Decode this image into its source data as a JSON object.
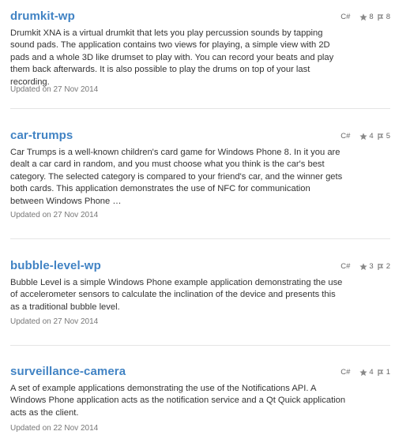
{
  "repos": [
    {
      "name": "drumkit-wp",
      "language": "C#",
      "stars": "8",
      "forks": "8",
      "description": "Drumkit XNA is a virtual drumkit that lets you play percussion sounds by tapping sound pads. The application contains two views for playing, a simple view with 2D pads and a whole 3D like drumset to play with. You can record your beats and play them back afterwards. It is also possible to play the drums on top of your last recording.",
      "updated": "Updated on 27 Nov 2014"
    },
    {
      "name": "car-trumps",
      "language": "C#",
      "stars": "4",
      "forks": "5",
      "description": "Car Trumps is a well-known children's card game for Windows Phone 8. In it you are dealt a car card in random, and you must choose what you think is the car's best category. The selected category is compared to your friend's car, and the winner gets both cards. This application demonstrates the use of NFC for communication between Windows Phone …",
      "updated": "Updated on 27 Nov 2014"
    },
    {
      "name": "bubble-level-wp",
      "language": "C#",
      "stars": "3",
      "forks": "2",
      "description": "Bubble Level is a simple Windows Phone example application demonstrating the use of accelerometer sensors to calculate the inclination of the device and presents this as a traditional bubble level.",
      "updated": "Updated on 27 Nov 2014"
    },
    {
      "name": "surveillance-camera",
      "language": "C#",
      "stars": "4",
      "forks": "1",
      "description": "A set of example applications demonstrating the use of the Notifications API. A Windows Phone application acts as the notification service and a Qt Quick application acts as the client.",
      "updated": "Updated on 22 Nov 2014"
    }
  ],
  "icons": {
    "star": "star-icon",
    "fork": "fork-icon"
  },
  "colors": {
    "link": "#4183c4",
    "text": "#333333",
    "muted": "#777777",
    "divider": "#e5e5e5"
  }
}
